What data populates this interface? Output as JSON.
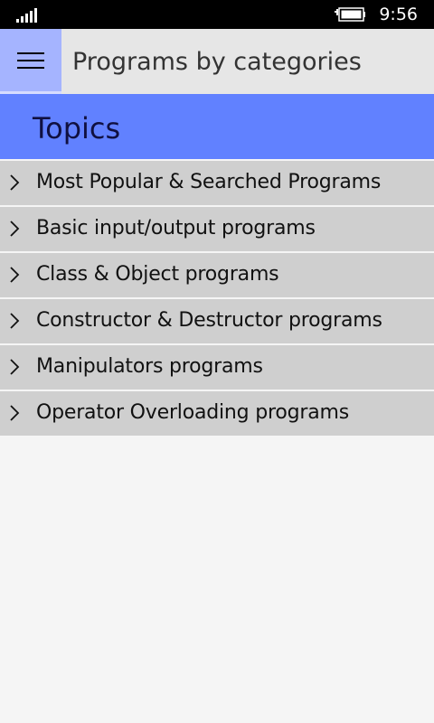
{
  "status_bar": {
    "time": "9:56",
    "signal_icon": "signal-strength-icon",
    "battery_icon": "battery-charging-icon"
  },
  "header": {
    "menu_icon": "hamburger-menu-icon",
    "title": "Programs by categories"
  },
  "topics": {
    "title": "Topics",
    "items": [
      {
        "label": "Most Popular & Searched Programs",
        "icon": "chevron-right-icon"
      },
      {
        "label": "Basic input/output programs",
        "icon": "chevron-right-icon"
      },
      {
        "label": "Class & Object programs",
        "icon": "chevron-right-icon"
      },
      {
        "label": "Constructor & Destructor programs",
        "icon": "chevron-right-icon"
      },
      {
        "label": "Manipulators programs",
        "icon": "chevron-right-icon"
      },
      {
        "label": "Operator Overloading programs",
        "icon": "chevron-right-icon"
      }
    ]
  },
  "colors": {
    "status_bar": "#000000",
    "header_background": "#e6e6e6",
    "menu_button": "#a5b4ff",
    "topics_banner": "#6181ff",
    "list_item": "#cfcfcf",
    "page_background": "#f5f5f5"
  }
}
